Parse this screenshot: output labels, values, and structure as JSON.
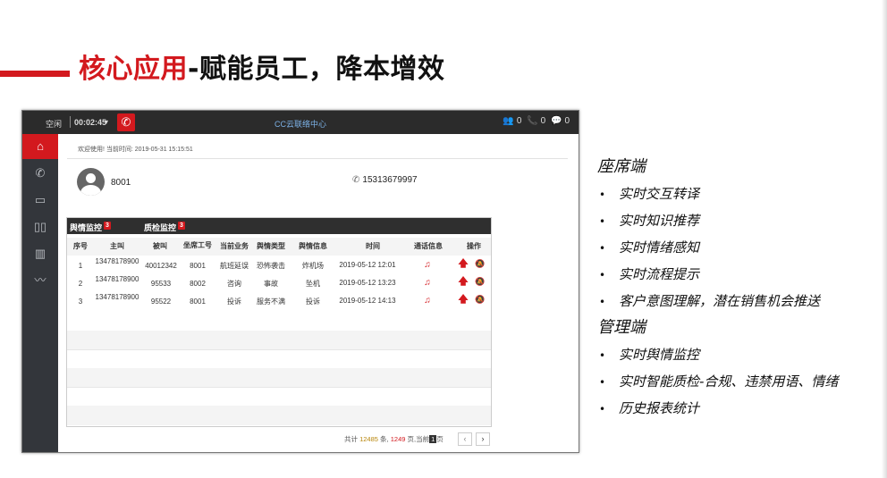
{
  "slide": {
    "title_red": "核心应用",
    "title_black": "-赋能员工，降本增效"
  },
  "app": {
    "topbar": {
      "status": "空闲",
      "timer": "00:02:45",
      "center_title": "CC云联络中心",
      "counters": [
        "0",
        "0",
        "0"
      ]
    },
    "sidebar_icons": [
      "home-icon",
      "phone-icon",
      "chat-icon",
      "book-icon",
      "bar-chart-icon",
      "line-chart-icon"
    ],
    "welcome": "欢迎使用! 当前时间: 2019-05-31 15:15:51",
    "agent_id": "8001",
    "phone": "15313679997",
    "tabs": [
      {
        "label": "舆情监控",
        "badge": "3"
      },
      {
        "label": "质检监控",
        "badge": "3"
      }
    ],
    "columns": [
      "序号",
      "主叫",
      "被叫",
      "坐席工号",
      "当前业务",
      "舆情类型",
      "舆情信息",
      "时间",
      "通话信息",
      "操作"
    ],
    "rows": [
      {
        "idx": "1",
        "caller": "13478178900",
        "callee": "40012342",
        "agent": "8001",
        "business": "航班延误",
        "type": "恐怖袭击",
        "info": "炸机场",
        "time": "2019-05-12 12:01"
      },
      {
        "idx": "2",
        "caller": "13478178900",
        "callee": "95533",
        "agent": "8002",
        "business": "咨询",
        "type": "事故",
        "info": "坠机",
        "time": "2019-05-12 13:23"
      },
      {
        "idx": "3",
        "caller": "13478178900",
        "callee": "95522",
        "agent": "8001",
        "business": "投诉",
        "type": "服务不满",
        "info": "投诉",
        "time": "2019-05-12 14:13"
      }
    ],
    "pager": {
      "prefix": "共计",
      "total": "12485",
      "mid": "条,",
      "pages": "1249",
      "mid2": "页,当前",
      "current": "1",
      "suffix": "页"
    }
  },
  "notes": {
    "seat_title": "座席端",
    "seat_items": [
      "实时交互转译",
      "实时知识推荐",
      "实时情绪感知",
      "实时流程提示",
      "客户意图理解，潜在销售机会推送"
    ],
    "mgr_title": "管理端",
    "mgr_items": [
      "实时舆情监控",
      "实时智能质检-合规、违禁用语、情绪",
      "历史报表统计"
    ]
  },
  "colors": {
    "accent": "#d3191e",
    "dark": "#2b2b2b",
    "sidebar": "#33363b"
  }
}
